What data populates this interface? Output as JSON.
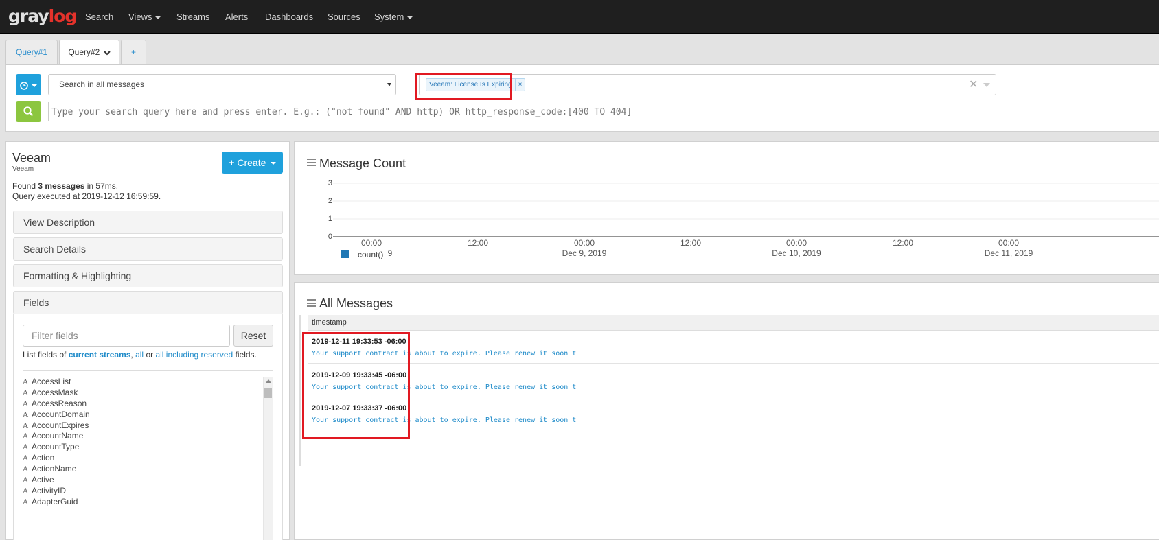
{
  "nav": {
    "logo_gray": "gray",
    "logo_log": "log",
    "items": [
      {
        "label": "Search"
      },
      {
        "label": "Views"
      },
      {
        "label": "Streams"
      },
      {
        "label": "Alerts"
      },
      {
        "label": "Dashboards"
      },
      {
        "label": "Sources"
      },
      {
        "label": "System"
      }
    ]
  },
  "tabs": [
    {
      "label": "Query#1"
    },
    {
      "label": "Query#2"
    },
    {
      "label": "+"
    }
  ],
  "search": {
    "stream_select_label": "Search in all messages",
    "saved_search_tag": "Veeam: License Is Expiring",
    "tag_remove": "×",
    "clear_symbol": "✕",
    "query_placeholder": "Type your search query here and press enter. E.g.: (\"not found\" AND http) OR http_response_code:[400 TO 404]"
  },
  "view": {
    "title": "Veeam",
    "subtitle": "Veeam",
    "found_prefix": "Found ",
    "found_count": "3 messages",
    "found_suffix": " in 57ms.",
    "executed": "Query executed at 2019-12-12 16:59:59.",
    "create_plus": "+",
    "create_label": "Create"
  },
  "sections": {
    "view_description": "View Description",
    "search_details": "Search Details",
    "formatting": "Formatting & Highlighting",
    "fields": "Fields"
  },
  "fields_panel": {
    "filter_placeholder": "Filter fields",
    "reset_label": "Reset",
    "list_prefix": "List fields of ",
    "current_streams": "current streams",
    "sep1": ", ",
    "all": "all",
    "sep2": " or ",
    "all_reserved": "all including reserved",
    "list_suffix": " fields.",
    "type_glyph": "A",
    "items": [
      "AccessList",
      "AccessMask",
      "AccessReason",
      "AccountDomain",
      "AccountExpires",
      "AccountName",
      "AccountType",
      "Action",
      "ActionName",
      "Active",
      "ActivityID",
      "AdapterGuid"
    ]
  },
  "count_widget": {
    "title": "Message Count",
    "y_ticks": [
      "3",
      "2",
      "1",
      "0"
    ],
    "x_ticks": [
      {
        "time": "00:00",
        "date": "9"
      },
      {
        "time": "12:00",
        "date": ""
      },
      {
        "time": "00:00",
        "date": "Dec 9, 2019"
      },
      {
        "time": "12:00",
        "date": ""
      },
      {
        "time": "00:00",
        "date": "Dec 10, 2019"
      },
      {
        "time": "12:00",
        "date": ""
      },
      {
        "time": "00:00",
        "date": "Dec 11, 2019"
      }
    ],
    "legend": "count()",
    "series_color": "#1f77b4"
  },
  "chart_data": {
    "type": "line",
    "title": "Message Count",
    "y_ticks": [
      0,
      1,
      2,
      3
    ],
    "ylim": [
      0,
      3
    ],
    "x_tick_labels": [
      "00:00",
      "12:00",
      "00:00 Dec 9, 2019",
      "12:00",
      "00:00 Dec 10, 2019",
      "12:00",
      "00:00 Dec 11, 2019"
    ],
    "series": [
      {
        "name": "count()",
        "values": []
      }
    ],
    "grid": true,
    "legend_position": "bottom-left"
  },
  "messages_widget": {
    "title": "All Messages",
    "column_header": "timestamp",
    "rows": [
      {
        "timestamp": "2019-12-11 19:33:53 -06:00",
        "message": "Your support contract is about to expire. Please renew it soon t"
      },
      {
        "timestamp": "2019-12-09 19:33:45 -06:00",
        "message": "Your support contract is about to expire. Please renew it soon t"
      },
      {
        "timestamp": "2019-12-07 19:33:37 -06:00",
        "message": "Your support contract is about to expire. Please renew it soon t"
      }
    ]
  },
  "colors": {
    "accent_blue": "#1fa1dc",
    "search_green": "#8cc63f",
    "highlight_red": "#e11922",
    "navbar": "#1f1f1f"
  }
}
